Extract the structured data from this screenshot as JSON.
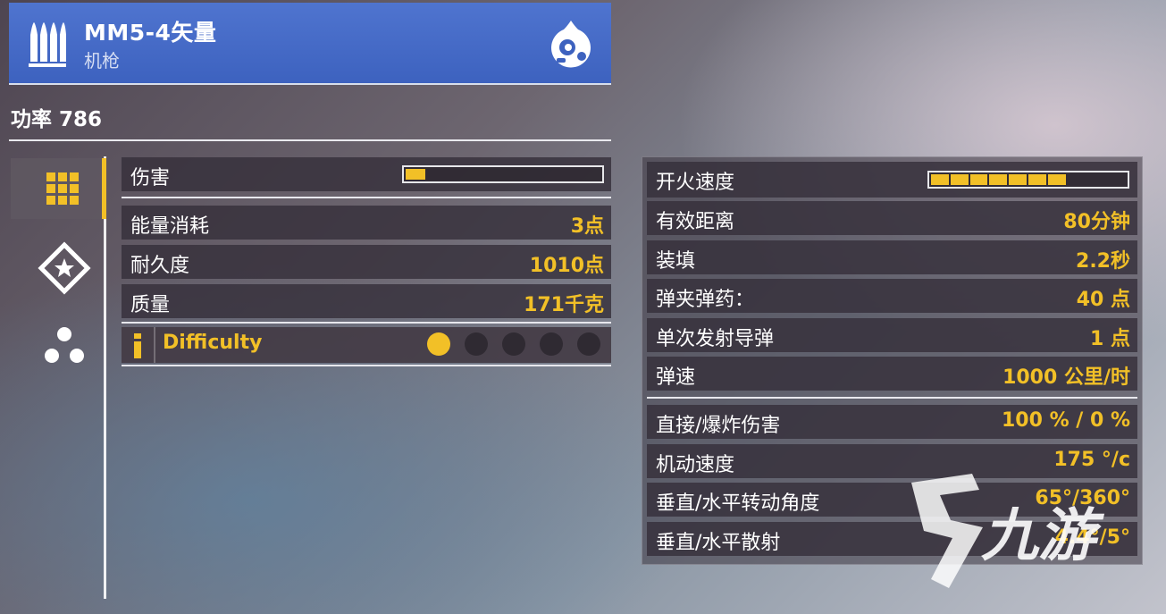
{
  "weapon": {
    "name": "MM5-4矢量",
    "class": "机枪",
    "power_label": "功率 786"
  },
  "sidebar": {
    "tabs": [
      {
        "icon": "grid-icon",
        "active": true
      },
      {
        "icon": "star-diamond-icon",
        "active": false
      },
      {
        "icon": "three-dots-icon",
        "active": false
      }
    ]
  },
  "left_stats": {
    "damage": {
      "label": "伤害",
      "fill": 0.1
    },
    "rows": [
      {
        "label": "能量消耗",
        "value": "3点"
      },
      {
        "label": "耐久度",
        "value": "1010点"
      },
      {
        "label": "质量",
        "value": "171千克"
      }
    ],
    "difficulty": {
      "label": "Difficulty",
      "level": 1,
      "max": 5
    }
  },
  "right_stats": {
    "fire_rate": {
      "label": "开火速度",
      "segments_filled": 7,
      "segments_total": 10
    },
    "group1": [
      {
        "label": "有效距离",
        "value": "80分钟"
      },
      {
        "label": "装填",
        "value": "2.2秒"
      },
      {
        "label": "弹夹弹药：",
        "value": "40 点"
      },
      {
        "label": "单次发射导弹",
        "value": "1 点"
      },
      {
        "label": "弹速",
        "value": "1000 公里/时"
      }
    ],
    "group2": [
      {
        "label": "直接/爆炸伤害",
        "value": "100 % / 0 %"
      },
      {
        "label": "机动速度",
        "value": "175 °/c"
      },
      {
        "label": "垂直/水平转动角度",
        "value": "65°/360°"
      },
      {
        "label": "垂直/水平散射",
        "value": "4.4°/5°"
      }
    ]
  },
  "watermark": {
    "text": "九游"
  },
  "colors": {
    "accent": "#f2c027",
    "header": "#4466c8",
    "dot_off": "#2f2a32"
  }
}
